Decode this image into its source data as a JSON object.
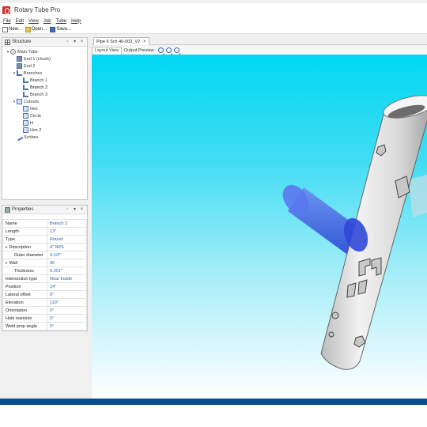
{
  "window": {
    "title": "Rotary Tube Pro"
  },
  "menu": [
    "File",
    "Edit",
    "View",
    "Job",
    "Tube",
    "Help"
  ],
  "toolbar": {
    "new_label": "New...",
    "open_label": "Open...",
    "save_label": "Save..."
  },
  "structure_panel": {
    "title": "Structure",
    "controls": [
      "▫",
      "▾",
      "×"
    ],
    "tree": [
      {
        "label": "Main Tube",
        "level": 0,
        "icon": "main-tube-icon",
        "toggle": "▾"
      },
      {
        "label": "End 1 (chuck)",
        "level": 1,
        "icon": "tube-end-icon",
        "toggle": ""
      },
      {
        "label": "End 2",
        "level": 1,
        "icon": "tube-end-icon",
        "toggle": ""
      },
      {
        "label": "Branches",
        "level": 1,
        "icon": "branch-icon",
        "toggle": "▾"
      },
      {
        "label": "Branch 1",
        "level": 2,
        "icon": "branch-icon",
        "toggle": ""
      },
      {
        "label": "Branch 2",
        "level": 2,
        "icon": "branch-icon",
        "toggle": "",
        "selected": true
      },
      {
        "label": "Branch 3",
        "level": 2,
        "icon": "branch-icon",
        "toggle": ""
      },
      {
        "label": "Cutouts",
        "level": 1,
        "icon": "cutout-icon",
        "toggle": "▾"
      },
      {
        "label": "Hex",
        "level": 2,
        "icon": "cutout-icon",
        "toggle": ""
      },
      {
        "label": "Circle",
        "level": 2,
        "icon": "cutout-icon",
        "toggle": ""
      },
      {
        "label": "H",
        "level": 2,
        "icon": "cutout-icon",
        "toggle": ""
      },
      {
        "label": "Hex 2",
        "level": 2,
        "icon": "cutout-icon",
        "toggle": ""
      },
      {
        "label": "Scribes",
        "level": 1,
        "icon": "scribe-icon",
        "toggle": ""
      }
    ]
  },
  "properties_panel": {
    "title": "Properties",
    "controls": [
      "▫",
      "▾",
      "×"
    ],
    "rows": [
      {
        "key": "Name",
        "value": "Branch 2"
      },
      {
        "key": "Length",
        "value": "13\""
      },
      {
        "key": "Type",
        "value": "Round"
      },
      {
        "key": "Description",
        "value": "4\" NPS",
        "expander": true
      },
      {
        "key": "Outer diameter",
        "value": "4-1/2\"",
        "indent": true
      },
      {
        "key": "Wall",
        "value": "40",
        "expander": true
      },
      {
        "key": "Thickness",
        "value": "0.201\"",
        "indent": true
      },
      {
        "key": "Intersection type",
        "value": "Near Inside"
      },
      {
        "key": "Position",
        "value": "14\""
      },
      {
        "key": "Lateral offset",
        "value": "0\""
      },
      {
        "key": "Elevation",
        "value": "110°"
      },
      {
        "key": "Orientation",
        "value": "0°"
      },
      {
        "key": "Hole oversize",
        "value": "0\""
      },
      {
        "key": "Weld prep angle",
        "value": "0°"
      }
    ]
  },
  "document": {
    "tab_label": "Pipe 6 Sch 40-003_V2",
    "close_glyph": "×",
    "view_tabs": [
      {
        "label": "Layout View",
        "active": true
      },
      {
        "label": "Output Preview",
        "active": false
      }
    ]
  },
  "colors": {
    "viewport_top": "#00d8f2",
    "viewport_bottom": "#ffffff",
    "tube_fill": "#d8d8d8",
    "branch_fill": "#3b5ee8",
    "status_bar": "#0a4e8a",
    "value_text": "#2a5db0"
  }
}
